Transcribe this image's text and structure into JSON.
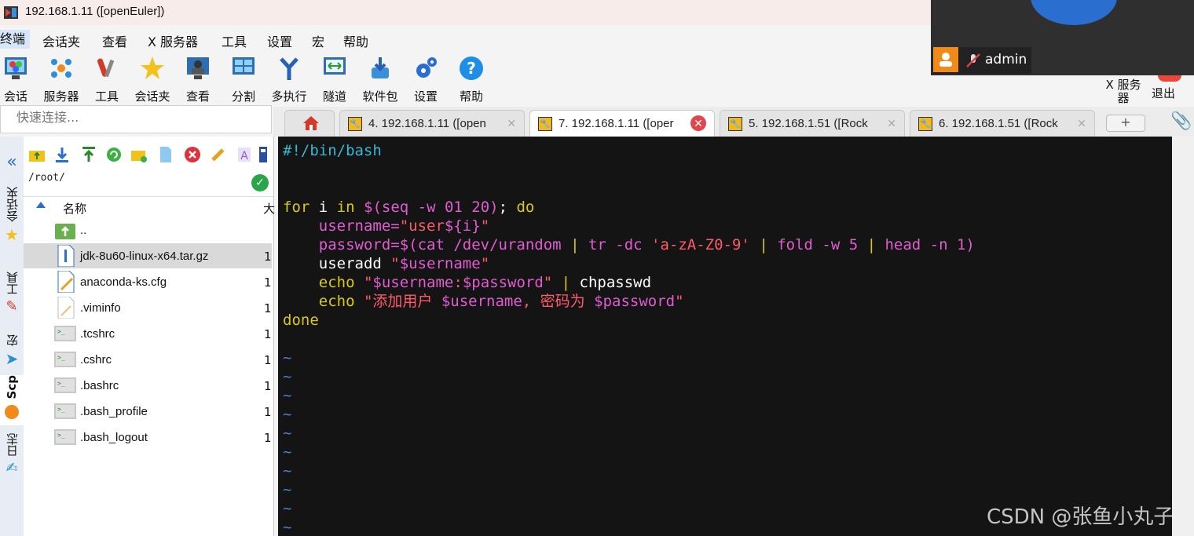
{
  "window": {
    "title": "192.168.1.11 ([openEuler])"
  },
  "menu": [
    "终端",
    "会话夹",
    "查看",
    "X 服务器",
    "工具",
    "设置",
    "宏",
    "帮助"
  ],
  "toolbar": [
    {
      "label": "会话",
      "icon": "session-icon"
    },
    {
      "label": "服务器",
      "icon": "servers-icon"
    },
    {
      "label": "工具",
      "icon": "tools-icon"
    },
    {
      "label": "会话夹",
      "icon": "star-icon"
    },
    {
      "label": "查看",
      "icon": "view-icon"
    },
    {
      "label": "分割",
      "icon": "split-icon"
    },
    {
      "label": "多执行",
      "icon": "multiexec-icon"
    },
    {
      "label": "隧道",
      "icon": "tunnel-icon"
    },
    {
      "label": "软件包",
      "icon": "packages-icon"
    },
    {
      "label": "设置",
      "icon": "settings-icon"
    },
    {
      "label": "帮助",
      "icon": "help-icon"
    }
  ],
  "right_buttons": {
    "xserver": "X 服务器",
    "exit": "退出"
  },
  "video": {
    "user": "admin"
  },
  "quick_connect": {
    "placeholder": "快速连接..."
  },
  "tabs": [
    {
      "label": "4. 192.168.1.11 ([open",
      "active": false
    },
    {
      "label": "7. 192.168.1.11 ([oper",
      "active": true
    },
    {
      "label": "5. 192.168.1.51 ([Rock",
      "active": false
    },
    {
      "label": "6. 192.168.1.51 ([Rock",
      "active": false
    }
  ],
  "side_tabs": [
    "会话夹",
    "工具",
    "宏",
    "Scp",
    "日志"
  ],
  "file_panel": {
    "path": "/root/",
    "columns": {
      "name": "名称",
      "size": "大"
    },
    "files": [
      {
        "name": "..",
        "size": "",
        "type": "parent"
      },
      {
        "name": "jdk-8u60-linux-x64.tar.gz",
        "size": "1",
        "type": "archive",
        "selected": true
      },
      {
        "name": "anaconda-ks.cfg",
        "size": "1",
        "type": "cfg"
      },
      {
        "name": ".viminfo",
        "size": "1",
        "type": "file"
      },
      {
        "name": ".tcshrc",
        "size": "1",
        "type": "shell"
      },
      {
        "name": ".cshrc",
        "size": "1",
        "type": "shell"
      },
      {
        "name": ".bashrc",
        "size": "1",
        "type": "shell"
      },
      {
        "name": ".bash_profile",
        "size": "1",
        "type": "shell"
      },
      {
        "name": ".bash_logout",
        "size": "1",
        "type": "shell"
      }
    ]
  },
  "terminal": {
    "lines": [
      [
        {
          "t": "#!/bin/bash",
          "c": "cmt"
        }
      ],
      [],
      [],
      [
        {
          "t": "for",
          "c": "kw"
        },
        {
          "t": " i ",
          "c": ""
        },
        {
          "t": "in",
          "c": "kw"
        },
        {
          "t": " ",
          "c": ""
        },
        {
          "t": "$(seq -w 01 20)",
          "c": "var"
        },
        {
          "t": "; ",
          "c": ""
        },
        {
          "t": "do",
          "c": "kw"
        }
      ],
      [
        {
          "t": "    username=",
          "c": "var"
        },
        {
          "t": "\"user",
          "c": "str"
        },
        {
          "t": "${i}",
          "c": "var"
        },
        {
          "t": "\"",
          "c": "str"
        }
      ],
      [
        {
          "t": "    password=",
          "c": "var"
        },
        {
          "t": "$(cat /dev/urandom ",
          "c": "var"
        },
        {
          "t": "|",
          "c": "pipe"
        },
        {
          "t": " tr -dc ",
          "c": "var"
        },
        {
          "t": "'a-zA-Z0-9'",
          "c": "str"
        },
        {
          "t": " | ",
          "c": "pipe"
        },
        {
          "t": "fold -w 5 ",
          "c": "var"
        },
        {
          "t": "|",
          "c": "pipe"
        },
        {
          "t": " head -n 1)",
          "c": "var"
        }
      ],
      [
        {
          "t": "    useradd ",
          "c": ""
        },
        {
          "t": "\"",
          "c": "str"
        },
        {
          "t": "$username",
          "c": "var"
        },
        {
          "t": "\"",
          "c": "str"
        }
      ],
      [
        {
          "t": "    echo ",
          "c": "kw"
        },
        {
          "t": "\"",
          "c": "str"
        },
        {
          "t": "$username",
          "c": "var"
        },
        {
          "t": ":",
          "c": "str"
        },
        {
          "t": "$password",
          "c": "var"
        },
        {
          "t": "\"",
          "c": "str"
        },
        {
          "t": " | ",
          "c": "pipe"
        },
        {
          "t": "chpasswd",
          "c": ""
        }
      ],
      [
        {
          "t": "    echo ",
          "c": "kw"
        },
        {
          "t": "\"添加用户 ",
          "c": "str"
        },
        {
          "t": "$username",
          "c": "var"
        },
        {
          "t": ", 密码为 ",
          "c": "str"
        },
        {
          "t": "$password",
          "c": "var"
        },
        {
          "t": "\"",
          "c": "str"
        }
      ],
      [
        {
          "t": "done",
          "c": "kw"
        }
      ],
      [],
      [
        {
          "t": "~",
          "c": "tilde"
        }
      ],
      [
        {
          "t": "~",
          "c": "tilde"
        }
      ],
      [
        {
          "t": "~",
          "c": "tilde"
        }
      ],
      [
        {
          "t": "~",
          "c": "tilde"
        }
      ],
      [
        {
          "t": "~",
          "c": "tilde"
        }
      ],
      [
        {
          "t": "~",
          "c": "tilde"
        }
      ],
      [
        {
          "t": "~",
          "c": "tilde"
        }
      ],
      [
        {
          "t": "~",
          "c": "tilde"
        }
      ],
      [
        {
          "t": "~",
          "c": "tilde"
        }
      ],
      [
        {
          "t": "~",
          "c": "tilde"
        }
      ]
    ]
  },
  "watermark": "CSDN @张鱼小丸子",
  "colors": {
    "terminal_bg": "#141414",
    "keyword": "#d8c81a",
    "comment": "#37b7d4",
    "string": "#ff5a6a",
    "variable": "#e05cd0",
    "active_tab_close": "#e0474c"
  }
}
